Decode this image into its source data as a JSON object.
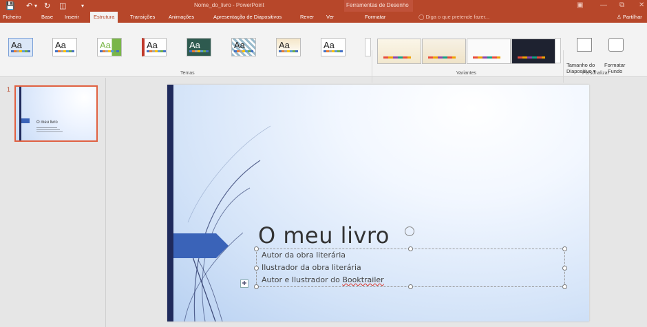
{
  "titlebar": {
    "document_title": "Nome_do_livro - PowerPoint",
    "contextual_title": "Ferramentas de Desenho"
  },
  "tabs": [
    {
      "label": "Ficheiro"
    },
    {
      "label": "Base"
    },
    {
      "label": "Inserir"
    },
    {
      "label": "Estrutura"
    },
    {
      "label": "Transições"
    },
    {
      "label": "Animações"
    },
    {
      "label": "Apresentação de Diapositivos"
    },
    {
      "label": "Rever"
    },
    {
      "label": "Ver"
    },
    {
      "label": "Formatar"
    }
  ],
  "tell_me": "Diga o que pretende fazer...",
  "share_label": "Partilhar",
  "ribbon": {
    "themes_label": "Temas",
    "theme_sample": "Aa",
    "variants_label": "Variantes",
    "customize_label": "Personalizar",
    "slide_size_label_1": "Tamanho do",
    "slide_size_label_2": "Diapositivo ▾",
    "format_bg_label_1": "Formatar",
    "format_bg_label_2": "Fundo"
  },
  "slide_pane": {
    "slide_number": "1",
    "thumb_title": "O meu livro"
  },
  "slide": {
    "title": "O meu livro",
    "subtitle_lines": [
      "Autor da obra literária",
      "Ilustrador da obra literária",
      "Autor e Ilustrador do "
    ],
    "misspelled_word": "Booktrailer"
  },
  "colors": {
    "accent": "#b7472a",
    "slide_bar": "#1f2a5c",
    "slide_arrow": "#3a63b8"
  },
  "icons": [
    "save-icon",
    "undo-icon",
    "redo-icon",
    "start-presentation-icon",
    "customize-qat-icon",
    "lightbulb-icon",
    "person-icon",
    "slide-size-icon",
    "format-background-icon",
    "rotate-handle-icon",
    "layout-options-icon"
  ]
}
